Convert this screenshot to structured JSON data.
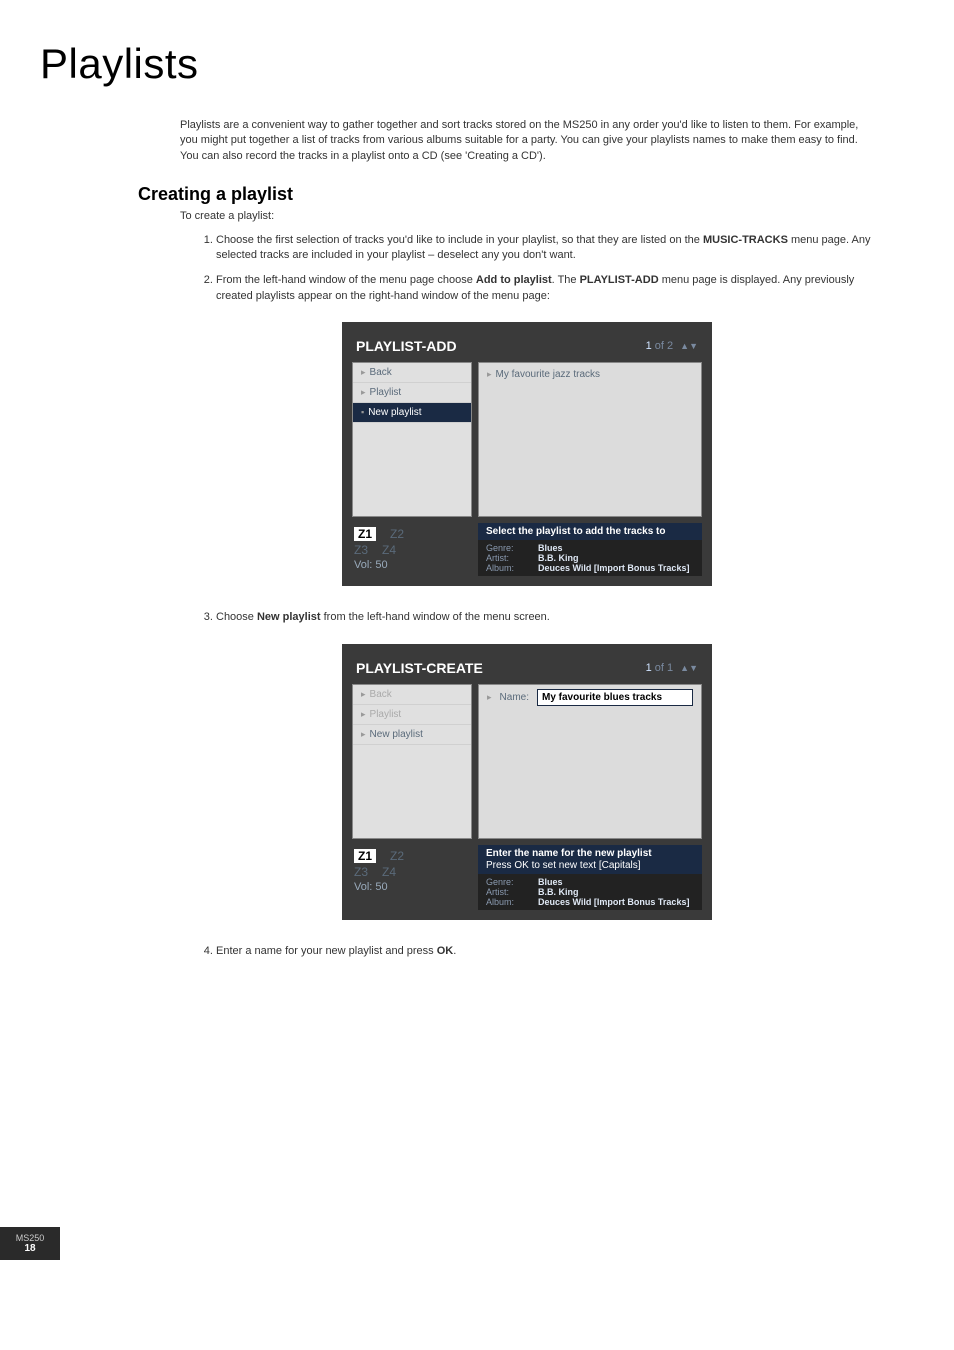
{
  "page_title": "Playlists",
  "intro": "Playlists are a convenient way to gather together and sort tracks stored on the MS250 in any order you'd like to listen to them. For example, you might put together a list of tracks from various albums suitable for a party. You can give your playlists names to make them easy to find. You can also record the tracks in a playlist onto a CD (see 'Creating a CD').",
  "section_title": "Creating a playlist",
  "lead": "To create a playlist:",
  "step1_a": "Choose the first selection of tracks you'd like to include in your playlist, so that they are listed on the ",
  "step1_b": "MUSIC-TRACKS",
  "step1_c": " menu page. Any selected tracks are included in your playlist – deselect any you don't want.",
  "step2_a": "From the left-hand window of the menu page choose ",
  "step2_b": "Add to playlist",
  "step2_c": ". The ",
  "step2_d": "PLAYLIST-ADD",
  "step2_e": " menu page is displayed. Any previously created playlists appear on the right-hand window of the menu page:",
  "step3_a": "Choose ",
  "step3_b": "New playlist",
  "step3_c": " from the left-hand window of the menu screen.",
  "step4_a": "Enter a name for your new playlist and press ",
  "step4_b": "OK",
  "step4_c": ".",
  "shot1": {
    "title": "PLAYLIST-ADD",
    "page_cur": "1",
    "page_total": "of 2",
    "left": {
      "back": "Back",
      "playlist": "Playlist",
      "new": "New playlist"
    },
    "right_item": "My favourite jazz tracks",
    "info_bar": "Select the playlist to add the tracks to",
    "meta": {
      "genre_lbl": "Genre:",
      "genre_val": "Blues",
      "artist_lbl": "Artist:",
      "artist_val": "B.B. King",
      "album_lbl": "Album:",
      "album_val": "Deuces Wild [Import Bonus Tracks]"
    },
    "zones": {
      "z1": "Z1",
      "z2": "Z2",
      "z3": "Z3",
      "z4": "Z4",
      "vol": "Vol:  50"
    }
  },
  "shot2": {
    "title": "PLAYLIST-CREATE",
    "page_cur": "1",
    "page_total": "of 1",
    "left": {
      "back": "Back",
      "playlist": "Playlist",
      "new": "New playlist"
    },
    "name_lbl": "Name:",
    "name_val": "My favourite blues tracks",
    "info_bar1": "Enter the name for the new playlist",
    "info_bar2": "Press OK to set new text [Capitals]",
    "meta": {
      "genre_lbl": "Genre:",
      "genre_val": "Blues",
      "artist_lbl": "Artist:",
      "artist_val": "B.B. King",
      "album_lbl": "Album:",
      "album_val": "Deuces Wild [Import Bonus Tracks]"
    },
    "zones": {
      "z1": "Z1",
      "z2": "Z2",
      "z3": "Z3",
      "z4": "Z4",
      "vol": "Vol:  50"
    }
  },
  "footer": {
    "model": "MS250",
    "page": "18"
  }
}
